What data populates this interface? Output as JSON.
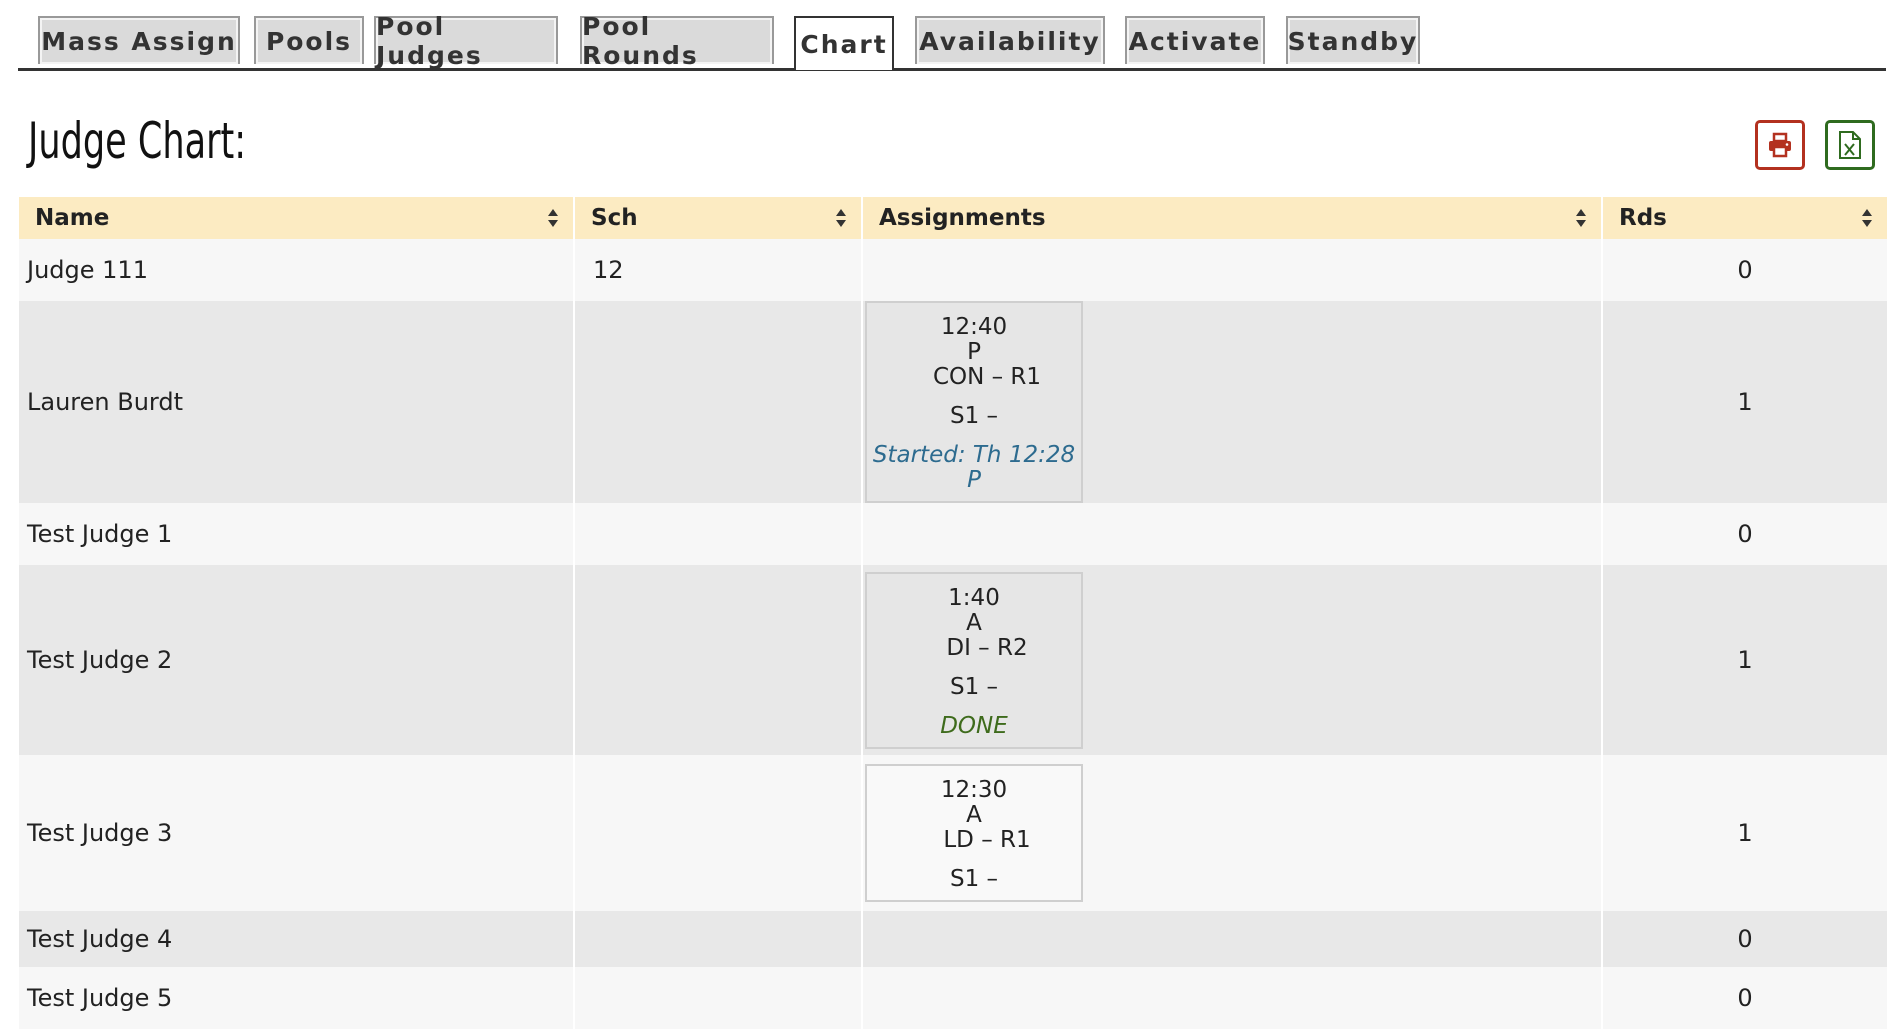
{
  "tabs": [
    {
      "label": "Mass Assign",
      "active": false
    },
    {
      "label": "Pools",
      "active": false
    },
    {
      "label": "Pool Judges",
      "active": false
    },
    {
      "label": "Pool Rounds",
      "active": false
    },
    {
      "label": "Chart",
      "active": true
    },
    {
      "label": "Availability",
      "active": false
    },
    {
      "label": "Activate",
      "active": false
    },
    {
      "label": "Standby",
      "active": false
    }
  ],
  "page_title": "Judge Chart:",
  "actions": {
    "print_icon": "printer-icon",
    "excel_icon": "excel-file-icon",
    "print_color": "#b3311f",
    "excel_color": "#2f6b1f"
  },
  "table": {
    "headers": [
      "Name",
      "Sch",
      "Assignments",
      "Rds"
    ],
    "rows": [
      {
        "name": "Judge 111",
        "sch": "12",
        "assignment": null,
        "rds": "0"
      },
      {
        "name": "Lauren Burdt",
        "sch": "",
        "assignment": {
          "time": "12:40",
          "ampm": "P",
          "event": "CON – R1",
          "site": "S1 –",
          "status": "Started: Th 12:28 P",
          "status_type": "started"
        },
        "rds": "1"
      },
      {
        "name": "Test Judge 1",
        "sch": "",
        "assignment": null,
        "rds": "0"
      },
      {
        "name": "Test Judge 2",
        "sch": "",
        "assignment": {
          "time": "1:40",
          "ampm": "A",
          "event": "DI – R2",
          "site": "S1 –",
          "status": "DONE",
          "status_type": "done"
        },
        "rds": "1"
      },
      {
        "name": "Test Judge 3",
        "sch": "",
        "assignment": {
          "time": "12:30",
          "ampm": "A",
          "event": "LD – R1",
          "site": "S1 –",
          "status": "",
          "status_type": "none"
        },
        "rds": "1"
      },
      {
        "name": "Test Judge 4",
        "sch": "",
        "assignment": null,
        "rds": "0"
      },
      {
        "name": "Test Judge 5",
        "sch": "",
        "assignment": null,
        "rds": "0"
      }
    ]
  },
  "colors": {
    "header_bg": "#fcebc2",
    "row_odd": "#f7f7f7",
    "row_even": "#e8e8e8",
    "started": "#2d6b8f",
    "done": "#3e6b1c"
  }
}
